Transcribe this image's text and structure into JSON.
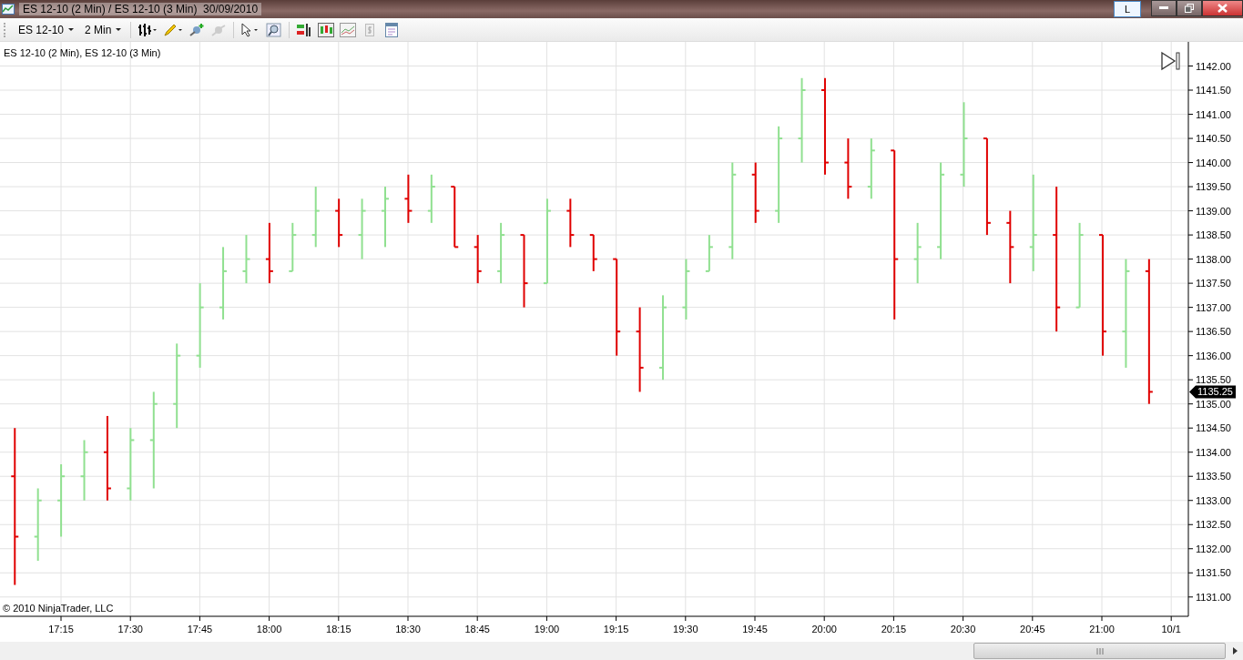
{
  "window": {
    "title": "ES 12-10 (2 Min) / ES 12-10 (3 Min)  30/09/2010",
    "layout_button": "L"
  },
  "toolbar": {
    "instrument": "ES 12-10",
    "interval": "2 Min"
  },
  "chart": {
    "label": "ES 12-10 (2 Min), ES 12-10 (3 Min)",
    "copyright": "© 2010 NinjaTrader, LLC",
    "last_price": "1135.25",
    "y_axis_labels": [
      "1142.00",
      "1141.50",
      "1141.00",
      "1140.50",
      "1140.00",
      "1139.50",
      "1139.00",
      "1138.50",
      "1138.00",
      "1137.50",
      "1137.00",
      "1136.50",
      "1136.00",
      "1135.50",
      "1135.00",
      "1134.50",
      "1134.00",
      "1133.50",
      "1133.00",
      "1132.50",
      "1132.00",
      "1131.50",
      "1131.00"
    ],
    "x_axis_labels": [
      "17:15",
      "17:30",
      "17:45",
      "18:00",
      "18:15",
      "18:30",
      "18:45",
      "19:00",
      "19:15",
      "19:30",
      "19:45",
      "20:00",
      "20:15",
      "20:30",
      "20:45",
      "21:00",
      "10/1"
    ]
  }
}
